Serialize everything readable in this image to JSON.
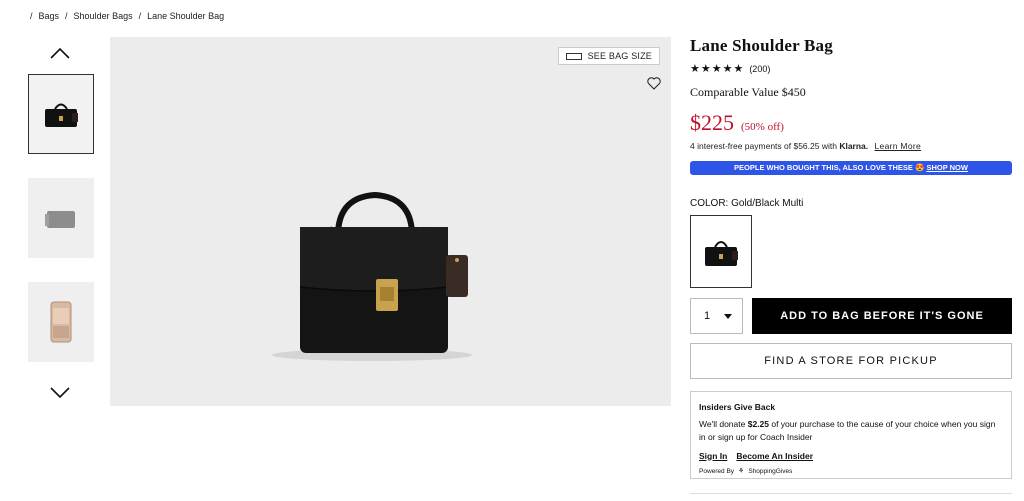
{
  "breadcrumb": {
    "sep": "/",
    "items": [
      "Bags",
      "Shoulder Bags",
      "Lane Shoulder Bag"
    ]
  },
  "gallery": {
    "icons": {
      "up": "chevron-up-icon",
      "down": "chevron-down-icon",
      "favorite": "heart-icon",
      "size": "ruler-icon"
    },
    "see_bag_size": "SEE BAG SIZE"
  },
  "product": {
    "title": "Lane Shoulder Bag",
    "stars": "★★★★★",
    "rating_value": 4.5,
    "review_count": "(200)",
    "comparable_value": "Comparable Value  $450",
    "price": "$225",
    "discount": "(50% off)",
    "klarna_text": "4 interest-free payments of $56.25 with",
    "klarna_brand": "Klarna.",
    "klarna_link": "Learn More",
    "promo_text": "PEOPLE WHO BOUGHT THIS, ALSO LOVE THESE 😍",
    "promo_link": "SHOP NOW",
    "color_label": "COLOR:",
    "color_value": "Gold/Black Multi",
    "quantity": "1",
    "add_to_bag": "ADD TO BAG BEFORE IT'S GONE",
    "find_store": "FIND A STORE FOR PICKUP"
  },
  "insiders": {
    "heading": "Insiders Give Back",
    "text_before": "We'll donate ",
    "amount": "$2.25",
    "text_after": " of your purchase to the cause of your choice when you sign in or sign up for Coach Insider",
    "sign_in": "Sign In",
    "become": "Become An Insider",
    "powered_by": "Powered By",
    "brand": "ShoppingGives"
  },
  "colors": {
    "price": "#c0112a",
    "promo_bg": "#2f55e8",
    "button_bg": "#000000"
  }
}
